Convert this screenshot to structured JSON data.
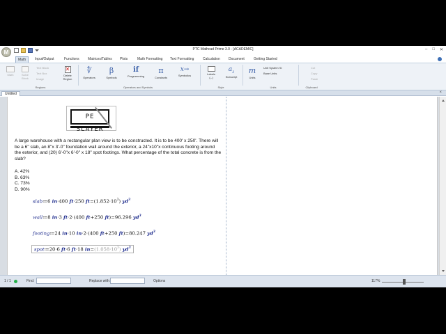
{
  "window": {
    "title": "PTC Mathcad Prime 3.0 - [ACADEMIC]",
    "app_logo": "M",
    "controls": [
      "–",
      "□",
      "✕"
    ]
  },
  "ribbon_tabs": [
    "Math",
    "Input/Output",
    "Functions",
    "Matrices/Tables",
    "Plots",
    "Math Formatting",
    "Text Formatting",
    "Calculation",
    "Document",
    "Getting Started"
  ],
  "ribbon": {
    "regions_group": {
      "buttons": [
        "Math",
        "Solve Block",
        "Text Block",
        "Text Box",
        "Image",
        "Delete Region"
      ],
      "label": "Regions"
    },
    "operators_group": {
      "buttons": [
        "Operators",
        "Symbols",
        "Programming",
        "Constants",
        "Symbolics"
      ],
      "label": "Operators and Symbols"
    },
    "style_group": {
      "buttons": [
        "Labels",
        "Subscript"
      ],
      "label": "Style",
      "labels_value": "(--)"
    },
    "units_group": {
      "buttons": [
        "Units"
      ],
      "unit_system": "Unit System",
      "unit_system_value": "SI",
      "base_units": "Base Units",
      "label": "Units"
    },
    "clipboard_group": {
      "buttons": [
        "Cut",
        "Copy",
        "Paste"
      ],
      "label": "Clipboard"
    }
  },
  "document_tab": {
    "label": "Untitled",
    "close": "×"
  },
  "logo_text": "PE SLAYER",
  "problem_text": "A large warehouse with a rectangular plan view is to be constructed. It is to be 400' x 250'. There will be a 6\" slab, an 8\"x 3'-0\" foundation wall around the exterior, a 24\"x10\"x continuous footing around the exterior, and (20) 6'-0\"x 6'-0\" x 18\" spot footings. What percentage of the total concrete is from the slab?",
  "choices": [
    "A. 42%",
    "B. 63%",
    "C. 73%",
    "D. 90%"
  ],
  "equations": {
    "slab": {
      "name": "slab",
      "expr_parts": [
        "6",
        "in",
        "400",
        "ft",
        "250",
        "ft"
      ],
      "result": "1.852",
      "exp": "3",
      "unit": "yd",
      "unit_exp": "3"
    },
    "wall": {
      "name": "wall",
      "result": "96.296",
      "unit": "yd",
      "unit_exp": "3"
    },
    "footing": {
      "name": "footing",
      "result": "80.247",
      "unit": "yd",
      "unit_exp": "3"
    },
    "spot": {
      "name": "spot",
      "result": "1.058",
      "exp": "3",
      "unit": "yd",
      "unit_exp": "3"
    }
  },
  "status": {
    "page": "1 / 1",
    "find_label": "Find:",
    "replace_label": "Replace with:",
    "options_label": "Options",
    "zoom": "117%"
  }
}
